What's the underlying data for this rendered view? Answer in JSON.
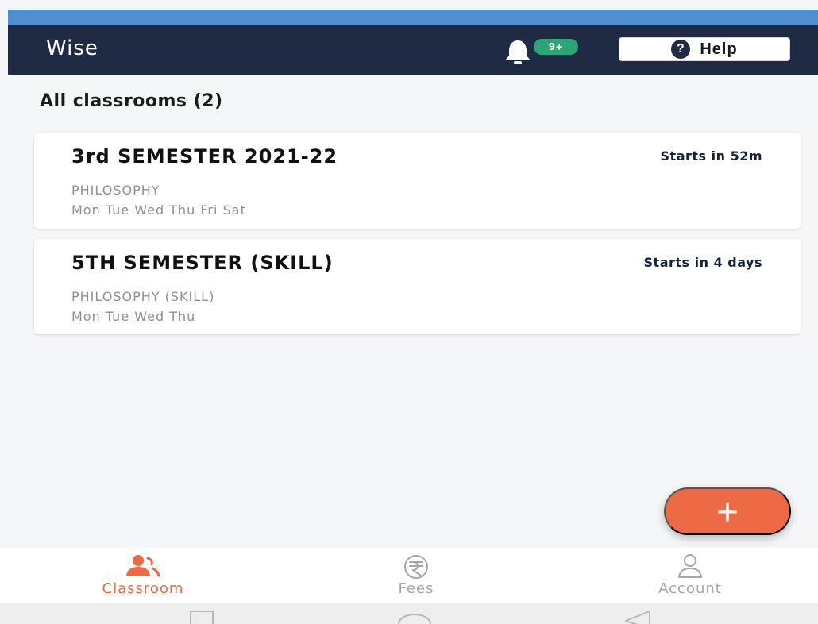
{
  "app_bar": {
    "title": "Wise",
    "notification_count": "9+",
    "help_label": "Help",
    "help_icon": "question-icon"
  },
  "section": {
    "title": "All classrooms (2)"
  },
  "classrooms": [
    {
      "title": "3rd SEMESTER 2021-22",
      "starts": "Starts in 52m",
      "subject": "PHILOSOPHY",
      "days": "Mon Tue Wed Thu Fri Sat"
    },
    {
      "title": "5TH SEMESTER (SKILL)",
      "starts": "Starts in 4 days",
      "subject": "PHILOSOPHY (SKILL)",
      "days": "Mon Tue Wed Thu"
    }
  ],
  "fab": {
    "icon": "plus-icon",
    "symbol": "+"
  },
  "bottom_nav": [
    {
      "label": "Classroom",
      "icon": "classroom-icon",
      "active": true
    },
    {
      "label": "Fees",
      "icon": "rupee-icon",
      "active": false
    },
    {
      "label": "Account",
      "icon": "account-icon",
      "active": false
    }
  ],
  "system_nav": {
    "buttons": [
      "recent-apps-icon",
      "home-icon",
      "back-icon"
    ]
  },
  "colors": {
    "app_bar": "#1f2a44",
    "accent": "#ee6a44",
    "badge": "#2aa676",
    "background": "#f5f6f7",
    "card": "#ffffff",
    "inactive": "#a6a6a6"
  }
}
